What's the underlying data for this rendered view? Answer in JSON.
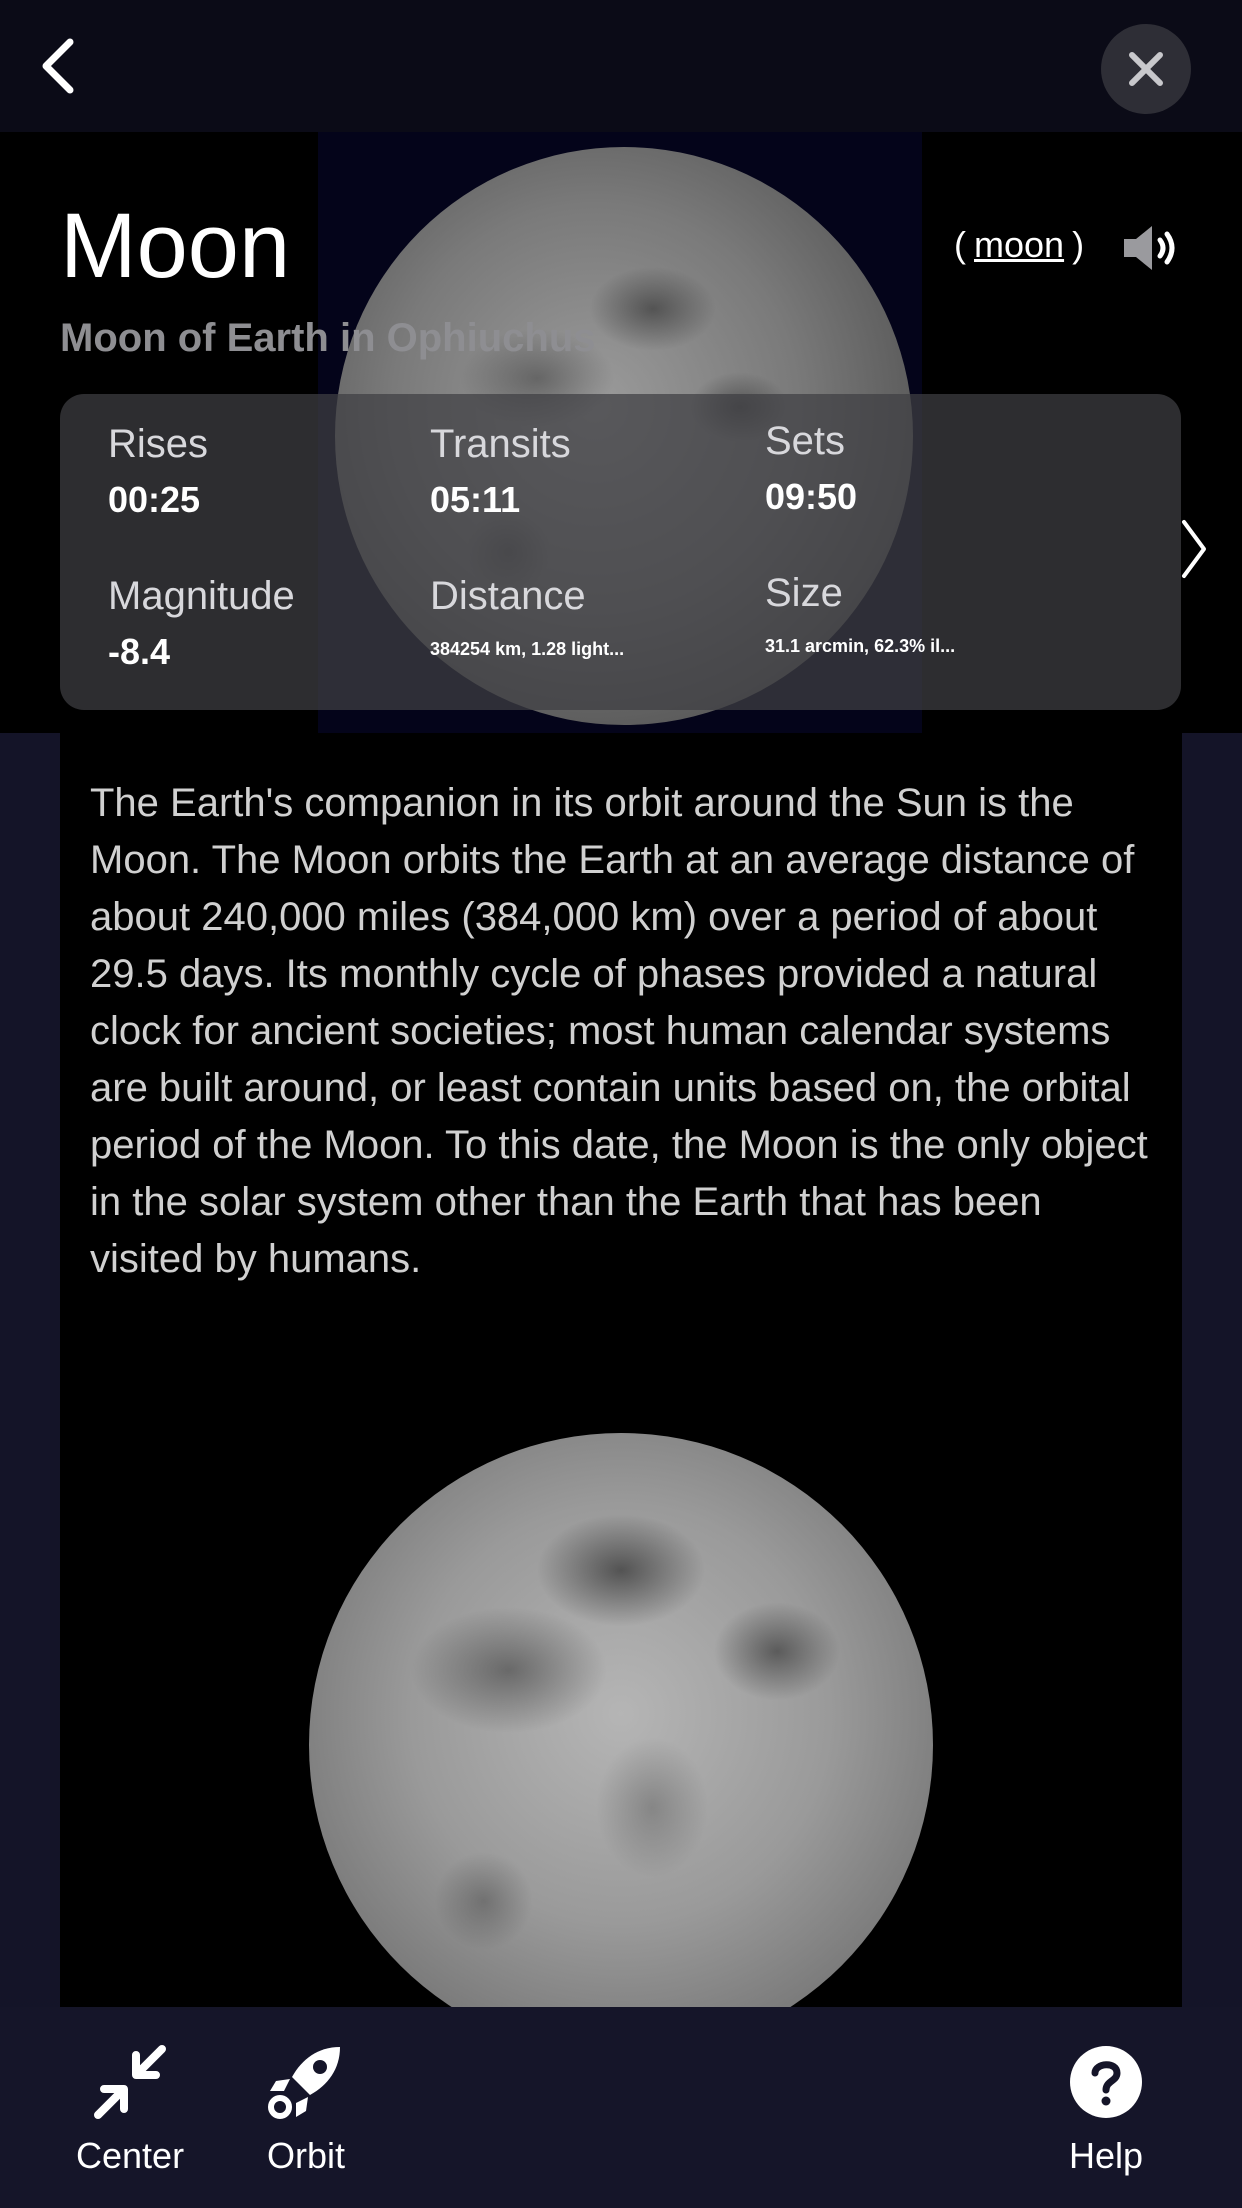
{
  "header": {
    "back_icon": "chevron-left-icon",
    "close_icon": "close-icon"
  },
  "object": {
    "name": "Moon",
    "subtitle": "Moon of Earth in Ophiuchus",
    "pronunciation_open": "(",
    "pronunciation_word": "moon",
    "pronunciation_close": ")",
    "speaker_icon": "speaker-icon"
  },
  "info": {
    "rises_label": "Rises",
    "rises_value": "00:25",
    "transits_label": "Transits",
    "transits_value": "05:11",
    "sets_label": "Sets",
    "sets_value": "09:50",
    "magnitude_label": "Magnitude",
    "magnitude_value": "-8.4",
    "distance_label": "Distance",
    "distance_value": "384254 km, 1.28 light...",
    "size_label": "Size",
    "size_value": "31.1 arcmin, 62.3% il...",
    "more_icon": "chevron-right-icon"
  },
  "description": "The Earth's companion in its orbit around the Sun is the Moon. The Moon orbits the Earth at an average distance of about 240,000 miles (384,000 km) over a period of about 29.5 days. Its monthly cycle of phases provided a natural clock for ancient societies; most human calendar systems are built around, or least contain units based on, the orbital period of the Moon. To this date, the Moon is the only object in the solar system other than the Earth that has been visited by humans.",
  "tabs": {
    "center_label": "Center",
    "orbit_label": "Orbit",
    "help_label": "Help"
  },
  "colors": {
    "background": "#141428",
    "topbar": "#0b0b17",
    "card": "#3e3e42",
    "subtitle": "#8e8e92"
  }
}
